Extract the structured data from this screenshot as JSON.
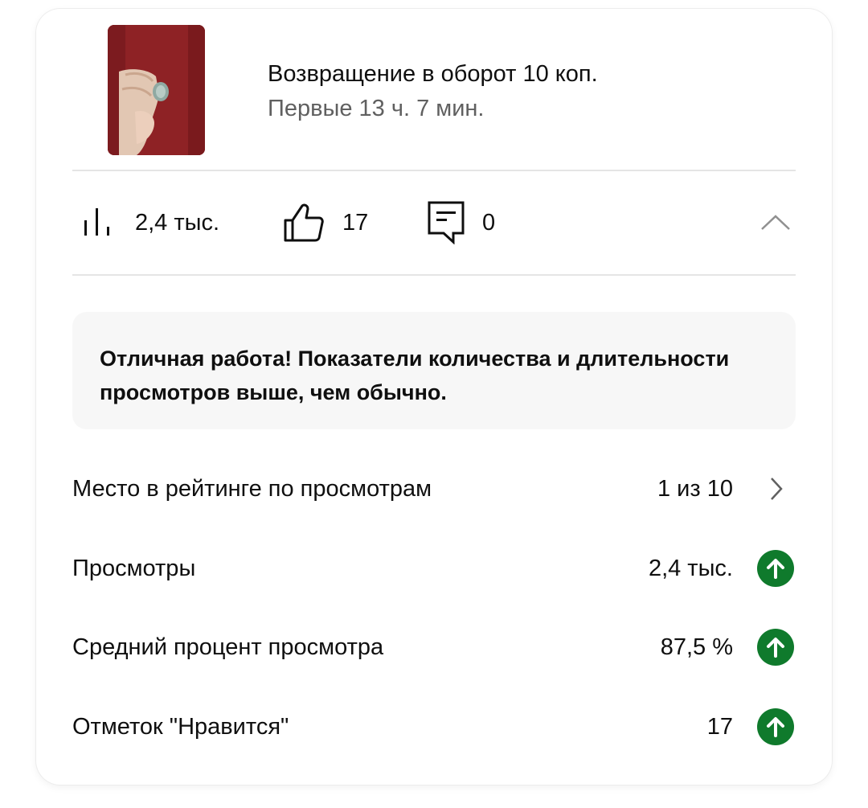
{
  "video": {
    "title": "Возвращение в оборот 10 коп.",
    "subtitle": "Первые 13 ч. 7 мин."
  },
  "stats": {
    "views": "2,4 тыс.",
    "likes": "17",
    "comments": "0"
  },
  "message": {
    "text": "Отличная работа! Показатели количества и длительности просмотров выше, чем обычно."
  },
  "metrics": [
    {
      "label": "Место в рейтинге по просмотрам",
      "value": "1 из 10",
      "trail": "chevron-right-icon"
    },
    {
      "label": "Просмотры",
      "value": "2,4 тыс.",
      "trail": "arrow-up-icon"
    },
    {
      "label": "Средний процент просмотра",
      "value": "87,5 %",
      "trail": "arrow-up-icon"
    },
    {
      "label": "Отметок \"Нравится\"",
      "value": "17",
      "trail": "arrow-up-icon"
    }
  ],
  "colors": {
    "positive_badge": "#0f7a2c",
    "secondary_text": "#606060",
    "message_bg": "#f7f7f7"
  }
}
